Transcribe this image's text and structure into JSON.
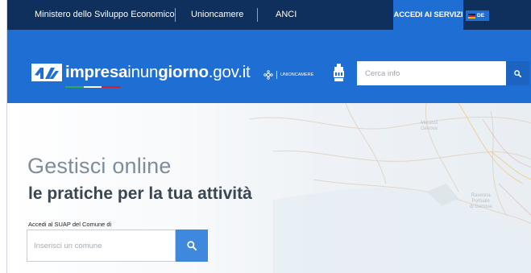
{
  "topbar": {
    "links": [
      {
        "label": "Ministero dello Sviluppo Economico"
      },
      {
        "label": "Unioncamere"
      },
      {
        "label": "ANCI"
      }
    ],
    "accedi_label": "ACCEDI AI SERVIZI",
    "lang_label": "DE",
    "lang_flag": "flag-de-icon"
  },
  "header": {
    "logo_bold_1": "impresa",
    "logo_light_1": "inun",
    "logo_bold_2": "giorno",
    "logo_light_2": ".gov.it",
    "partner_unioncamere": "UNIONCAMERE",
    "partner_anci_icon": "anci-logo",
    "search_placeholder": "Cerca info",
    "search_icon": "search-icon"
  },
  "hero": {
    "title": "Gestisci online",
    "subtitle": "le pratiche per la tua attività",
    "suap_label": "Accedi al SUAP del Comune di",
    "comune_placeholder": "Inserisci un comune",
    "map_labels": [
      {
        "text": "Marassi\nGenova"
      },
      {
        "text": "Ravenna\nPortuale\ndi Genova"
      }
    ]
  },
  "colors": {
    "topbar": "#0f2f5c",
    "header": "#1f6ed4",
    "accent_button": "#1f6ed4",
    "search_button": "#3e88dd"
  }
}
